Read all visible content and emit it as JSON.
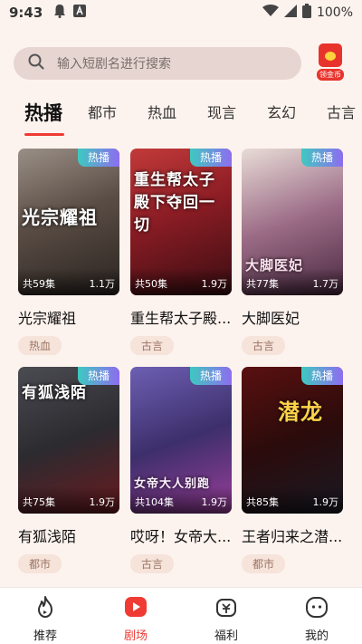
{
  "status_bar": {
    "time": "9:43",
    "battery": "100%"
  },
  "search": {
    "placeholder": "输入短剧名进行搜索",
    "coin_label": "领金币"
  },
  "tabs": [
    "热播",
    "都市",
    "热血",
    "现言",
    "玄幻",
    "古言"
  ],
  "active_tab": "热播",
  "dramas": [
    {
      "title": "光宗耀祖",
      "poster_text": "光宗耀祖",
      "badge": "热播",
      "episodes": "共59集",
      "plays": "1.1万",
      "tag": "热血"
    },
    {
      "title": "重生帮太子殿...",
      "poster_text": "重生帮太子殿下夺回一切",
      "badge": "热播",
      "episodes": "共50集",
      "plays": "1.9万",
      "tag": "古言"
    },
    {
      "title": "大脚医妃",
      "poster_text": "大脚医妃",
      "badge": "热播",
      "episodes": "共77集",
      "plays": "1.7万",
      "tag": "古言"
    },
    {
      "title": "有狐浅陌",
      "poster_text": "有狐浅陌",
      "badge": "热播",
      "episodes": "共75集",
      "plays": "1.9万",
      "tag": "都市"
    },
    {
      "title": "哎呀！女帝大...",
      "poster_text": "女帝大人别跑",
      "badge": "热播",
      "episodes": "共104集",
      "plays": "1.9万",
      "tag": "古言"
    },
    {
      "title": "王者归来之潜...",
      "poster_text": "潜龙",
      "badge": "热播",
      "episodes": "共85集",
      "plays": "1.9万",
      "tag": "都市"
    }
  ],
  "bottom_nav": [
    {
      "label": "推荐",
      "icon": "flame-icon"
    },
    {
      "label": "剧场",
      "icon": "play-icon"
    },
    {
      "label": "福利",
      "icon": "gift-icon"
    },
    {
      "label": "我的",
      "icon": "profile-icon"
    }
  ],
  "active_nav": "剧场",
  "colors": {
    "accent": "#ee3c34",
    "background": "#fdf3ee",
    "badge_start": "#3ec9c0",
    "badge_end": "#8e6cf0"
  }
}
